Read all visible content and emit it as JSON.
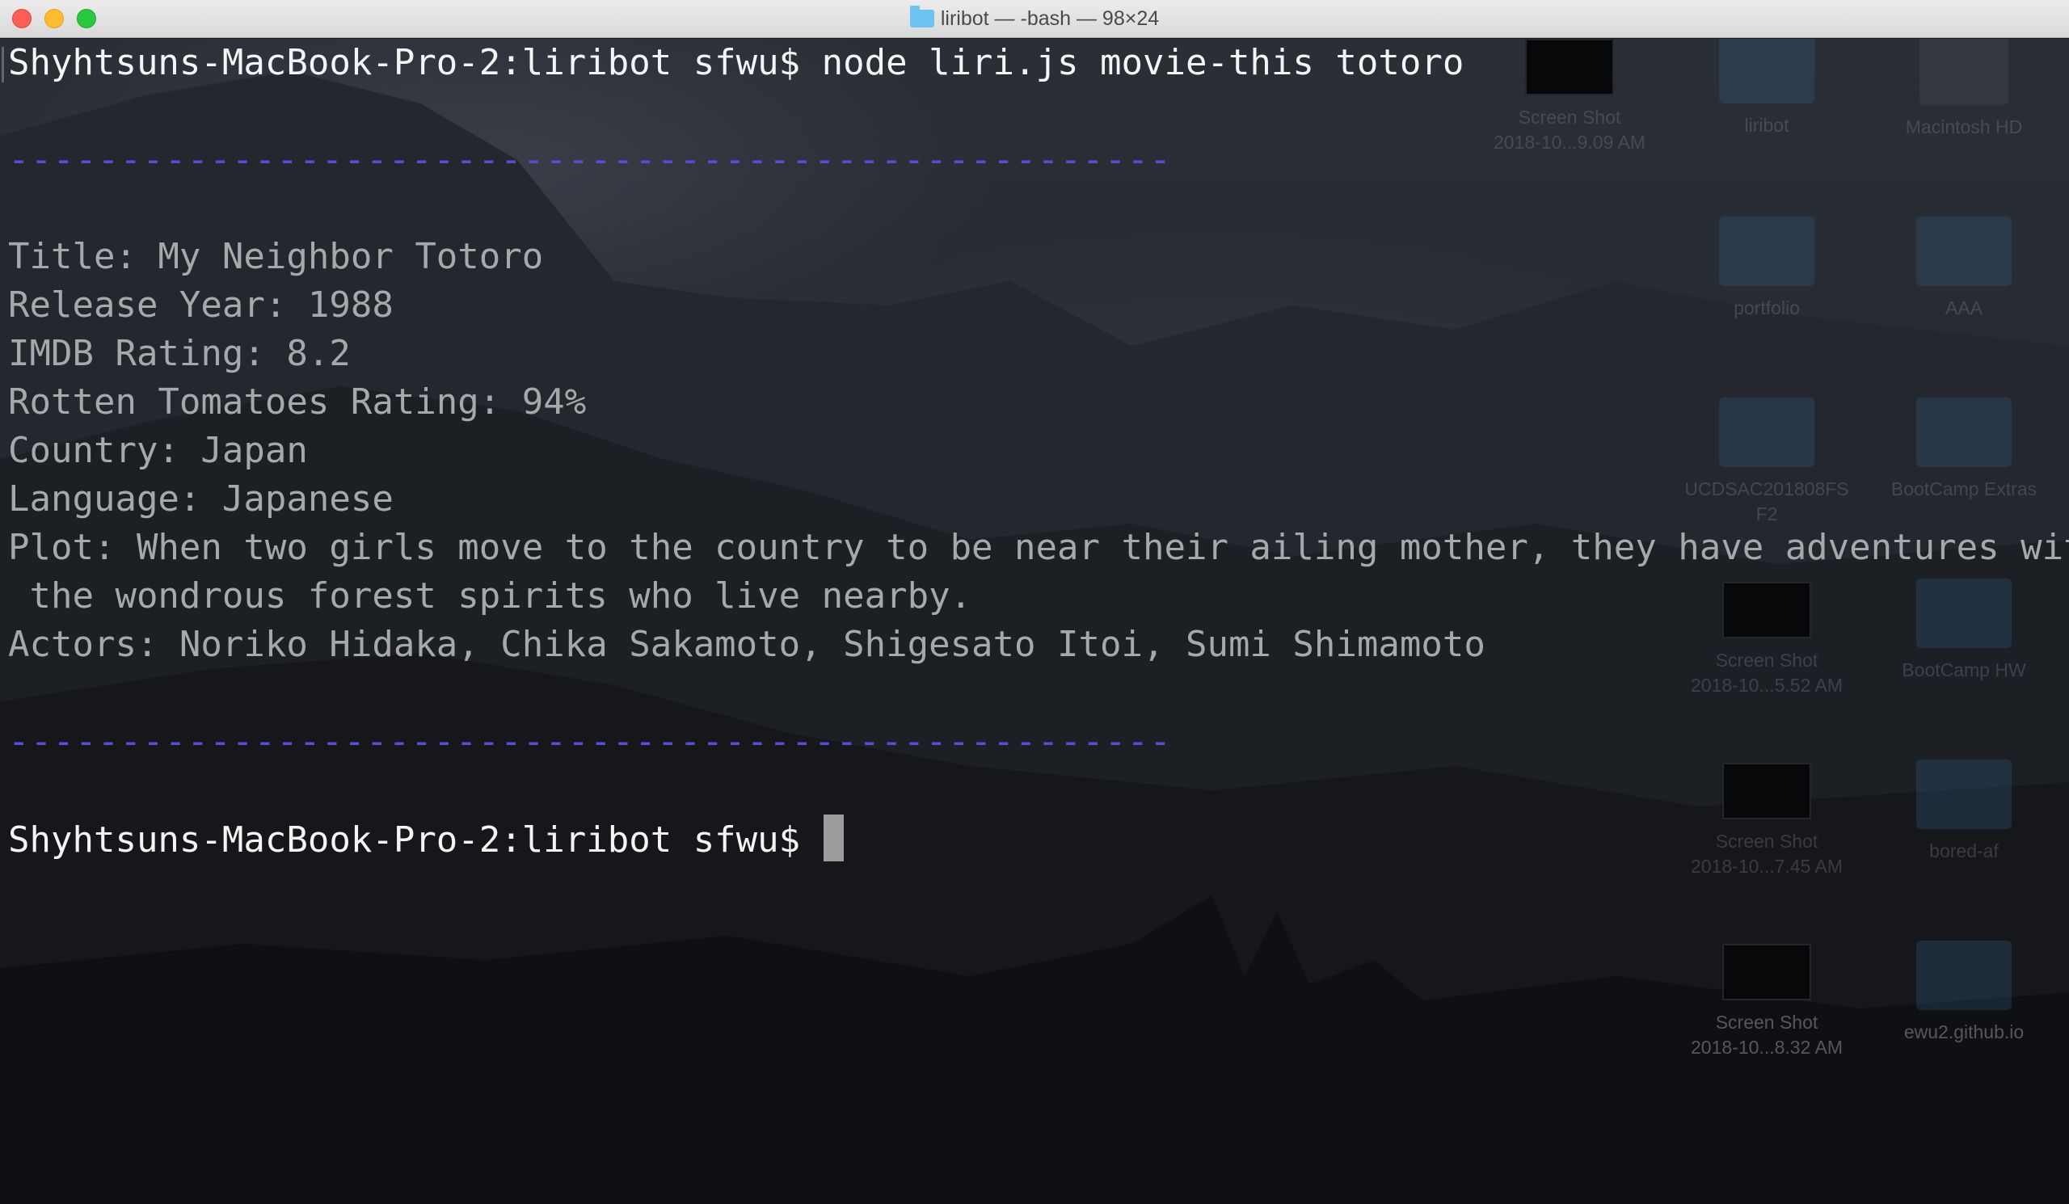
{
  "window": {
    "title": "liribot — -bash — 98×24",
    "folder_icon": "folder-icon",
    "traffic_lights": {
      "close": "#fd5f57",
      "minimize": "#febc2e",
      "maximize": "#28c840"
    }
  },
  "terminal": {
    "prompt_command": "Shyhtsuns-MacBook-Pro-2:liribot sfwu$ node liri.js movie-this totoro",
    "separator_top": "----------------------------------------------------",
    "output": [
      "Title: My Neighbor Totoro",
      "Release Year: 1988",
      "IMDB Rating: 8.2",
      "Rotten Tomatoes Rating: 94%",
      "Country: Japan",
      "Language: Japanese",
      "Plot: When two girls move to the country to be near their ailing mother, they have adventures with",
      " the wondrous forest spirits who live nearby.",
      "Actors: Noriko Hidaka, Chika Sakamoto, Shigesato Itoi, Sumi Shimamoto"
    ],
    "separator_bottom": "----------------------------------------------------",
    "prompt": "Shyhtsuns-MacBook-Pro-2:liribot sfwu$ ",
    "separator_color": "#5b4bd8"
  },
  "desktop": {
    "items": [
      {
        "label1": "Screen Shot",
        "label2": "2018-10...9.09 AM",
        "icon": "screenshot-thumbnail"
      },
      {
        "label1": "liribot",
        "label2": "",
        "icon": "folder-icon"
      },
      {
        "label1": "Macintosh HD",
        "label2": "",
        "icon": "hard-disk-icon"
      },
      {
        "label1": "portfolio",
        "label2": "",
        "icon": "folder-icon"
      },
      {
        "label1": "AAA",
        "label2": "",
        "icon": "folder-icon"
      },
      {
        "label1": "UCDSAC201808FS",
        "label2": "F2",
        "icon": "folder-icon"
      },
      {
        "label1": "BootCamp Extras",
        "label2": "",
        "icon": "folder-icon"
      },
      {
        "label1": "Screen Shot",
        "label2": "2018-10...5.52 AM",
        "icon": "screenshot-thumbnail"
      },
      {
        "label1": "BootCamp HW",
        "label2": "",
        "icon": "folder-icon"
      },
      {
        "label1": "Screen Shot",
        "label2": "2018-10...7.45 AM",
        "icon": "screenshot-thumbnail"
      },
      {
        "label1": "bored-af",
        "label2": "",
        "icon": "folder-icon"
      },
      {
        "label1": "Screen Shot",
        "label2": "2018-10...8.32 AM",
        "icon": "screenshot-thumbnail"
      },
      {
        "label1": "ewu2.github.io",
        "label2": "",
        "icon": "folder-icon"
      }
    ]
  }
}
